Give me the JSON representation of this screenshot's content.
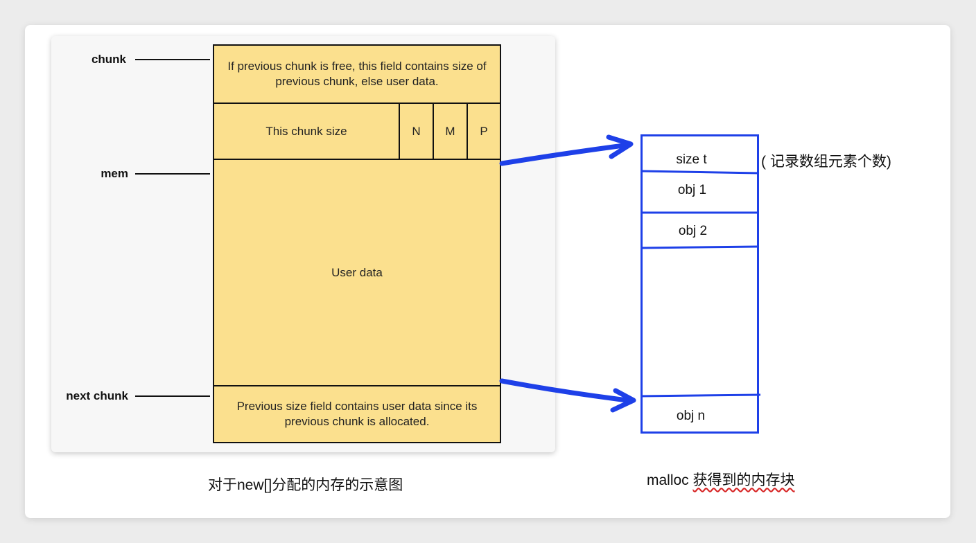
{
  "left_diagram": {
    "pointers": {
      "chunk": "chunk",
      "mem": "mem",
      "next_chunk": "next chunk"
    },
    "rows": {
      "prev_size": "If previous chunk is free, this field contains size of previous chunk, else user data.",
      "chunk_size": "This chunk size",
      "flag_n": "N",
      "flag_m": "M",
      "flag_p": "P",
      "user_data": "User data",
      "next_prev": "Previous size field contains user data since its previous chunk is allocated."
    },
    "caption": "对于new[]分配的内存的示意图"
  },
  "right_diagram": {
    "cells": {
      "size": "size t",
      "obj1": "obj 1",
      "obj2": "obj 2",
      "objn": "obj n"
    },
    "note": "( 记录数组元素个数)",
    "caption_prefix": "malloc ",
    "caption_underlined": "获得到的内存块"
  },
  "colors": {
    "chunk_fill": "#fbe08e",
    "arrow_blue": "#1e40e8"
  }
}
